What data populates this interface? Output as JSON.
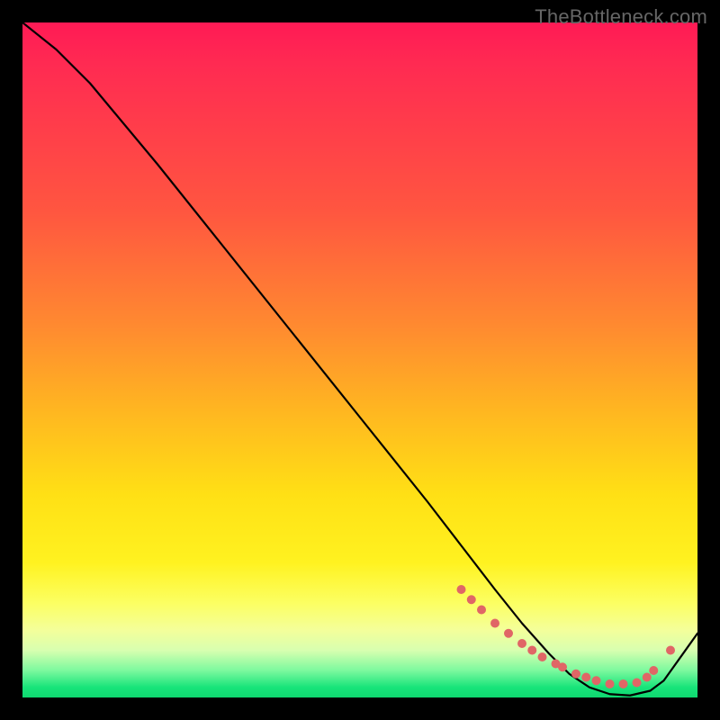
{
  "watermark": "TheBottleneck.com",
  "chart_data": {
    "type": "line",
    "title": "",
    "xlabel": "",
    "ylabel": "",
    "xlim": [
      0,
      100
    ],
    "ylim": [
      0,
      100
    ],
    "series": [
      {
        "name": "curve",
        "x": [
          0,
          5,
          10,
          20,
          30,
          40,
          50,
          60,
          65,
          70,
          74,
          78,
          81,
          84,
          87,
          90,
          93,
          95,
          100
        ],
        "y": [
          100,
          96,
          91,
          79,
          66.5,
          54,
          41.5,
          29,
          22.5,
          16,
          11,
          6.5,
          3.5,
          1.5,
          0.5,
          0.3,
          1.0,
          2.5,
          9.5
        ]
      }
    ],
    "markers": {
      "name": "dots",
      "color": "#e06666",
      "x": [
        65,
        66.5,
        68,
        70,
        72,
        74,
        75.5,
        77,
        79,
        80,
        82,
        83.5,
        85,
        87,
        89,
        91,
        92.5,
        93.5,
        96
      ],
      "y": [
        16,
        14.5,
        13,
        11,
        9.5,
        8,
        7,
        6,
        5,
        4.5,
        3.5,
        3,
        2.5,
        2,
        2,
        2.2,
        3,
        4,
        7
      ]
    },
    "gradient_stops": [
      {
        "pos": 0.0,
        "color": "#ff1a55"
      },
      {
        "pos": 0.28,
        "color": "#ff5640"
      },
      {
        "pos": 0.58,
        "color": "#ffb820"
      },
      {
        "pos": 0.8,
        "color": "#fff220"
      },
      {
        "pos": 0.93,
        "color": "#d8ffb0"
      },
      {
        "pos": 1.0,
        "color": "#0fd870"
      }
    ]
  }
}
